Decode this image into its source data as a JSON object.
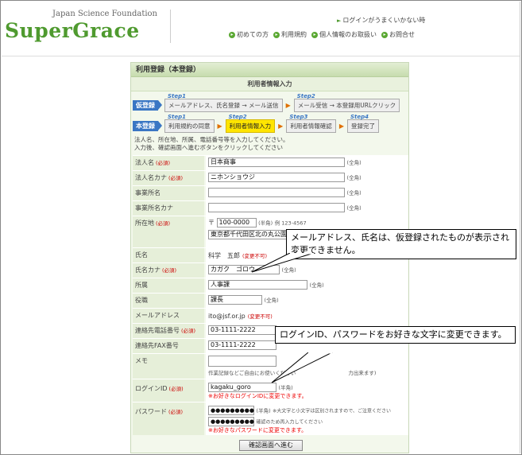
{
  "header": {
    "org_name": "Japan Science Foundation",
    "logo": "SuperGrace",
    "login_trouble": "ログインがうまくいかない時",
    "nav": [
      "初めての方",
      "利用規約",
      "個人情報のお取扱い",
      "お問合せ"
    ]
  },
  "panel": {
    "title": "利用登録（本登録）",
    "subtitle": "利用者情報入力"
  },
  "steps": {
    "provisional_tag": "仮登録",
    "provisional": [
      {
        "num": "Step1",
        "label": "メールアドレス、氏名登録 → メール送信"
      },
      {
        "num": "Step2",
        "label": "メール受信 → 本登録用URLクリック"
      }
    ],
    "full_tag": "本登録",
    "full": [
      {
        "num": "Step1",
        "label": "利用規約の同意"
      },
      {
        "num": "Step2",
        "label": "利用者情報入力"
      },
      {
        "num": "Step3",
        "label": "利用者情報確認"
      },
      {
        "num": "Step4",
        "label": "登録完了"
      }
    ]
  },
  "instruction": {
    "line1": "法人名、所在地、所属、電話番号等を入力してください。",
    "line2": "入力後、確認画面へ進むボタンをクリックしてください"
  },
  "common": {
    "required": "(必須)",
    "zenkaku": "(全角)",
    "hankaku": "(半角)",
    "readonly": "(変更不可)"
  },
  "form": {
    "corp_name": {
      "label": "法人名",
      "value": "日本商事"
    },
    "corp_kana": {
      "label": "法人名カナ",
      "value": "ニホンショウジ"
    },
    "office_name": {
      "label": "事業所名",
      "value": ""
    },
    "office_kana": {
      "label": "事業所名カナ",
      "value": ""
    },
    "address": {
      "label": "所在地",
      "postal_mark": "〒",
      "postal": "100-0000",
      "postal_example": "例 123-4567",
      "address_value": "東京都千代田区北の丸公園"
    },
    "name": {
      "label": "氏名",
      "value": "科学　五郎"
    },
    "name_kana": {
      "label": "氏名カナ",
      "value": "カガク　ゴロウ"
    },
    "department": {
      "label": "所属",
      "value": "人事課"
    },
    "position": {
      "label": "役職",
      "value": "課長"
    },
    "email": {
      "label": "メールアドレス",
      "value": "ito@jsf.or.jp"
    },
    "phone": {
      "label": "連絡先電話番号",
      "value": "03-1111-2222"
    },
    "fax": {
      "label": "連絡先FAX番号",
      "value": "03-1111-2222"
    },
    "memo": {
      "label": "メモ",
      "note": "作業記録などご自由にお使いください",
      "note_tail": "力出来ます)"
    },
    "login_id": {
      "label": "ログインID",
      "value": "kagaku_goro",
      "red_note": "※お好きなログインIDに変更できます。"
    },
    "password": {
      "label": "パスワード",
      "value": "●●●●●●●●●",
      "confirm_value": "●●●●●●●●●",
      "note1": "※大文字と小文字は区別されますので、ご注意ください",
      "note2": "確認のため再入力してください",
      "red_note": "※お好きなパスワードに変更できます。"
    }
  },
  "confirm_button": "確認画面へ進む",
  "callouts": {
    "email_name": "メールアドレス、氏名は、仮登録されたものが表示され変更できません。",
    "login": "ログインID、パスワードをお好きな文字に変更できます。"
  }
}
